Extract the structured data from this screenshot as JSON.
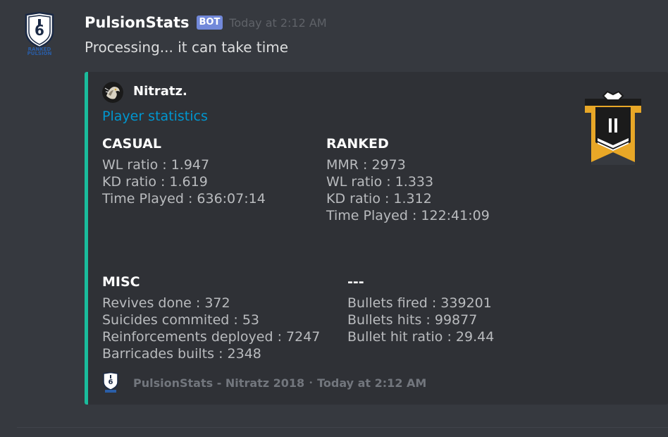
{
  "message": {
    "username": "PulsionStats",
    "bot_tag": "BOT",
    "timestamp": "Today at 2:12 AM",
    "text": "Processing... it can take time",
    "avatar_icon": "ranked-pulsion-shield-logo"
  },
  "embed": {
    "accent_color": "#1abc9c",
    "author": {
      "name": "Nitratz.",
      "icon": "player-avatar-icon"
    },
    "title": "Player statistics",
    "thumbnail_icon": "rank-badge-icon",
    "fields": {
      "casual": {
        "name": "CASUAL",
        "lines": [
          "WL ratio : 1.947",
          "KD ratio : 1.619",
          "Time Played : 636:07:14"
        ]
      },
      "ranked": {
        "name": "RANKED",
        "lines": [
          "MMR : 2973",
          "WL ratio : 1.333",
          "KD ratio : 1.312",
          "Time Played : 122:41:09"
        ]
      },
      "misc": {
        "name": "MISC",
        "lines": [
          "Revives done : 372",
          "Suicides commited : 53",
          "Reinforcements deployed : 7247",
          "Barricades builts : 2348"
        ]
      },
      "extra": {
        "name": "---",
        "lines": [
          "Bullets fired : 339201",
          "Bullets hits : 99877",
          "Bullet hit ratio : 29.44"
        ]
      }
    },
    "footer": {
      "text": "PulsionStats - Nitratz 2018",
      "separator": "•",
      "timestamp": "Today at 2:12 AM",
      "icon": "ranked-pulsion-shield-logo"
    }
  },
  "colors": {
    "background": "#36393f",
    "embed_background": "#2f3136",
    "bot_tag": "#7289da",
    "link": "#0096cf",
    "rank_gold": "#e8a727"
  }
}
